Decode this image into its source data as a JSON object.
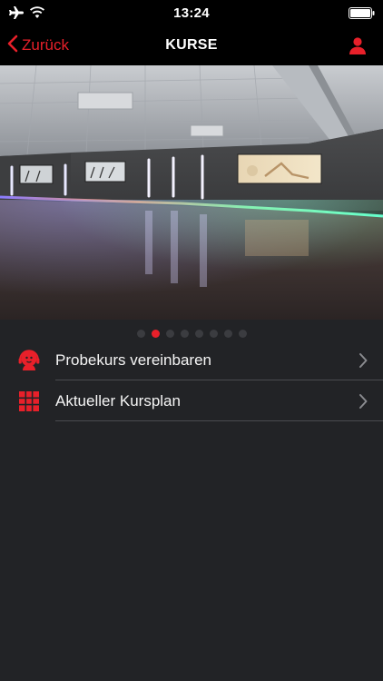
{
  "status_bar": {
    "time": "13:24",
    "icons": [
      "airplane-icon",
      "wifi-icon",
      "battery-icon"
    ]
  },
  "nav": {
    "back_label": "Zurück",
    "title": "KURSE",
    "profile_icon": "person-icon"
  },
  "hero": {
    "image": "fitness-studio-photo",
    "slide_count": 8,
    "active_slide": 2
  },
  "menu": {
    "items": [
      {
        "label": "Probekurs vereinbaren",
        "icon": "headset-person-icon"
      },
      {
        "label": "Aktueller Kursplan",
        "icon": "grid-schedule-icon"
      }
    ]
  },
  "colors": {
    "accent": "#e8202a",
    "background": "#222326",
    "bar": "#000000",
    "divider": "#4a4b4f"
  }
}
